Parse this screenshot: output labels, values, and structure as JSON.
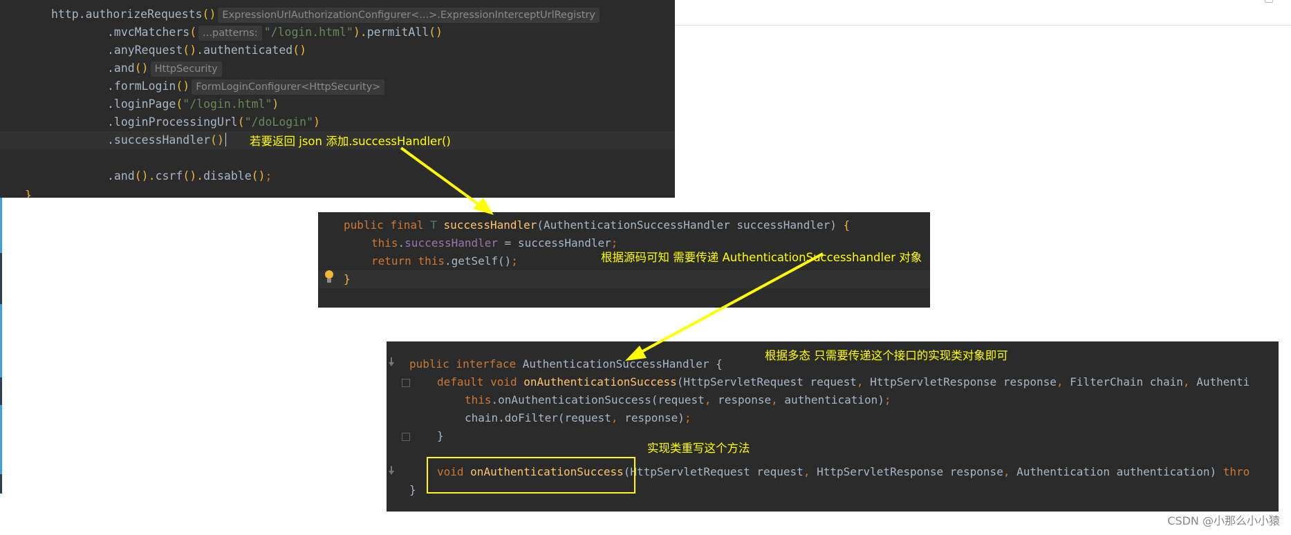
{
  "panel1": {
    "lines": {
      "l1": {
        "t1": "http.authorizeRequests",
        "t2": "()",
        "hint": "ExpressionUrlAuthorizationConfigurer<...>.ExpressionInterceptUrlRegistry"
      },
      "l2": {
        "t1": ".mvcMatchers",
        "t2": "(",
        "hint": "...patterns:",
        "str": "\"/login.html\"",
        "t3": ").",
        "t4": "permitAll",
        "t5": "()"
      },
      "l3": {
        "t1": ".anyRequest",
        "t2": "()",
        "t3": ".authenticated",
        "t4": "()"
      },
      "l4": {
        "t1": ".and",
        "t2": "()",
        "hint": "HttpSecurity"
      },
      "l5": {
        "t1": ".formLogin",
        "t2": "()",
        "hint": "FormLoginConfigurer<HttpSecurity>"
      },
      "l6": {
        "t1": ".loginPage",
        "t2": "(",
        "str": "\"/login.html\"",
        "t3": ")"
      },
      "l7": {
        "t1": ".loginProcessingUrl",
        "t2": "(",
        "str": "\"/doLogin\"",
        "t3": ")"
      },
      "l8": {
        "t1": ".successHandler",
        "t2": "(",
        "t3": ")"
      },
      "l9": {
        "t1": ".and",
        "t2": "().",
        "t3": "csrf",
        "t4": "().",
        "t5": "disable",
        "t6": "()",
        "t7": ";"
      },
      "l10": {
        "t1": "}"
      }
    },
    "note": "若要返回 json  添加.successHandler()"
  },
  "panel2": {
    "l1": {
      "kw": "public final",
      "type": "T",
      "fn": "successHandler",
      "rest": "(AuthenticationSuccessHandler successHandler) ",
      "brace": "{"
    },
    "l2": {
      "kw": "this",
      "dot": ".",
      "fld": "successHandler",
      "rest": " = successHandler",
      "semi": ";"
    },
    "l3": {
      "kw": "return",
      "kw2": "this",
      "rest": ".getSelf()",
      "semi": ";"
    },
    "l4": {
      "brace": "}"
    },
    "note": "根据源码可知 需要传递 AuthenticationSuccesshandler 对象"
  },
  "panel3": {
    "l1": {
      "kw": "public interface",
      "rest": "AuthenticationSuccessHandler {"
    },
    "l2": {
      "kw": "default void",
      "fn": "onAuthenticationSuccess",
      "p1": "(HttpServletRequest request",
      "c1": ",",
      "p2": " HttpServletResponse response",
      "c2": ",",
      "p3": " FilterChain chain",
      "c3": ",",
      "p4": " Authenti"
    },
    "l3": {
      "kw": "this",
      "rest": ".onAuthenticationSuccess(request",
      "c1": ",",
      "p2": " response",
      "c2": ",",
      "p3": " authentication)",
      "semi": ";"
    },
    "l4": {
      "rest": "chain.doFilter(request",
      "c1": ",",
      "p2": " response)",
      "semi": ";"
    },
    "l5": {
      "brace": "}"
    },
    "l6": {
      "kw": "void",
      "fn": "onAuthenticationSuccess",
      "p1": "(HttpServletRequest request",
      "c1": ",",
      "p2": " HttpServletResponse response",
      "c2": ",",
      "p3": " Authentication authentication) ",
      "kw2": "thro"
    },
    "l7": {
      "brace": "}"
    },
    "note1": "根据多态 只需要传递这个接口的实现类对象即可",
    "note2": "实现类重写这个方法"
  },
  "watermark": "CSDN @小那么小小猿",
  "colors": {
    "editor_bg": "#2b2b2b",
    "keyword": "#cc7832",
    "method": "#ffc66d",
    "string": "#6a8759",
    "annotation": "#ffff00"
  }
}
